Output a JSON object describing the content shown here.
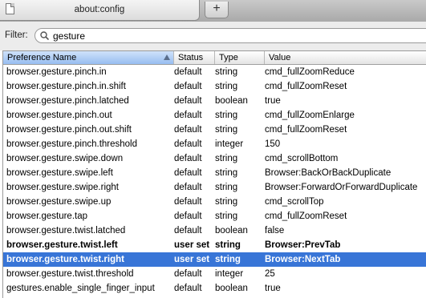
{
  "tab": {
    "title": "about:config",
    "new_tab_label": "+"
  },
  "filter": {
    "label": "Filter:",
    "value": "gesture"
  },
  "columns": {
    "name": "Preference Name",
    "status": "Status",
    "type": "Type",
    "value": "Value"
  },
  "rows": [
    {
      "name": "browser.gesture.pinch.in",
      "status": "default",
      "type": "string",
      "value": "cmd_fullZoomReduce"
    },
    {
      "name": "browser.gesture.pinch.in.shift",
      "status": "default",
      "type": "string",
      "value": "cmd_fullZoomReset"
    },
    {
      "name": "browser.gesture.pinch.latched",
      "status": "default",
      "type": "boolean",
      "value": "true"
    },
    {
      "name": "browser.gesture.pinch.out",
      "status": "default",
      "type": "string",
      "value": "cmd_fullZoomEnlarge"
    },
    {
      "name": "browser.gesture.pinch.out.shift",
      "status": "default",
      "type": "string",
      "value": "cmd_fullZoomReset"
    },
    {
      "name": "browser.gesture.pinch.threshold",
      "status": "default",
      "type": "integer",
      "value": "150"
    },
    {
      "name": "browser.gesture.swipe.down",
      "status": "default",
      "type": "string",
      "value": "cmd_scrollBottom"
    },
    {
      "name": "browser.gesture.swipe.left",
      "status": "default",
      "type": "string",
      "value": "Browser:BackOrBackDuplicate"
    },
    {
      "name": "browser.gesture.swipe.right",
      "status": "default",
      "type": "string",
      "value": "Browser:ForwardOrForwardDuplicate"
    },
    {
      "name": "browser.gesture.swipe.up",
      "status": "default",
      "type": "string",
      "value": "cmd_scrollTop"
    },
    {
      "name": "browser.gesture.tap",
      "status": "default",
      "type": "string",
      "value": "cmd_fullZoomReset"
    },
    {
      "name": "browser.gesture.twist.latched",
      "status": "default",
      "type": "boolean",
      "value": "false"
    },
    {
      "name": "browser.gesture.twist.left",
      "status": "user set",
      "type": "string",
      "value": "Browser:PrevTab"
    },
    {
      "name": "browser.gesture.twist.right",
      "status": "user set",
      "type": "string",
      "value": "Browser:NextTab"
    },
    {
      "name": "browser.gesture.twist.threshold",
      "status": "default",
      "type": "integer",
      "value": "25"
    },
    {
      "name": "gestures.enable_single_finger_input",
      "status": "default",
      "type": "boolean",
      "value": "true"
    }
  ],
  "colors": {
    "selection": "#3875d7",
    "sorted_header": "#97bdf0"
  }
}
